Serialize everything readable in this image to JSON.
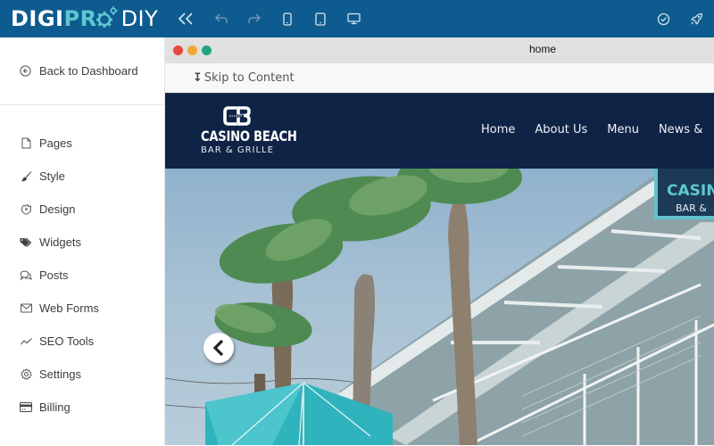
{
  "app": {
    "logo": {
      "part1": "DIGI",
      "part2": "PR",
      "part3": "DIY"
    },
    "toolbar": {
      "collapse": "collapse-sidebar",
      "undo": "undo",
      "redo": "redo",
      "mobile": "mobile-view",
      "tablet": "tablet-view",
      "desktop": "desktop-view",
      "check": "check-status",
      "publish": "publish"
    }
  },
  "sidebar": {
    "back_label": "Back to Dashboard",
    "items": [
      {
        "label": "Pages",
        "icon": "page-icon"
      },
      {
        "label": "Style",
        "icon": "brush-icon"
      },
      {
        "label": "Design",
        "icon": "design-icon"
      },
      {
        "label": "Widgets",
        "icon": "tags-icon"
      },
      {
        "label": "Posts",
        "icon": "comments-icon"
      },
      {
        "label": "Web Forms",
        "icon": "envelope-icon"
      },
      {
        "label": "SEO Tools",
        "icon": "trend-icon"
      },
      {
        "label": "Settings",
        "icon": "gear-icon"
      },
      {
        "label": "Billing",
        "icon": "credit-card-icon"
      }
    ]
  },
  "preview": {
    "window_title": "home",
    "skip_link": "Skip to Content",
    "site": {
      "brand_name": "CASINO BEACH",
      "brand_sub": "BAR & GRILLE",
      "nav": [
        "Home",
        "About Us",
        "Menu",
        "News &"
      ]
    },
    "hero": {
      "sign_name": "CASINO",
      "sign_sub": "BAR &"
    }
  },
  "colors": {
    "topbar": "#0e5c8f",
    "accent": "#5cc7cf",
    "site_header": "#0f2346",
    "umbrella": "#2fb3bd"
  }
}
